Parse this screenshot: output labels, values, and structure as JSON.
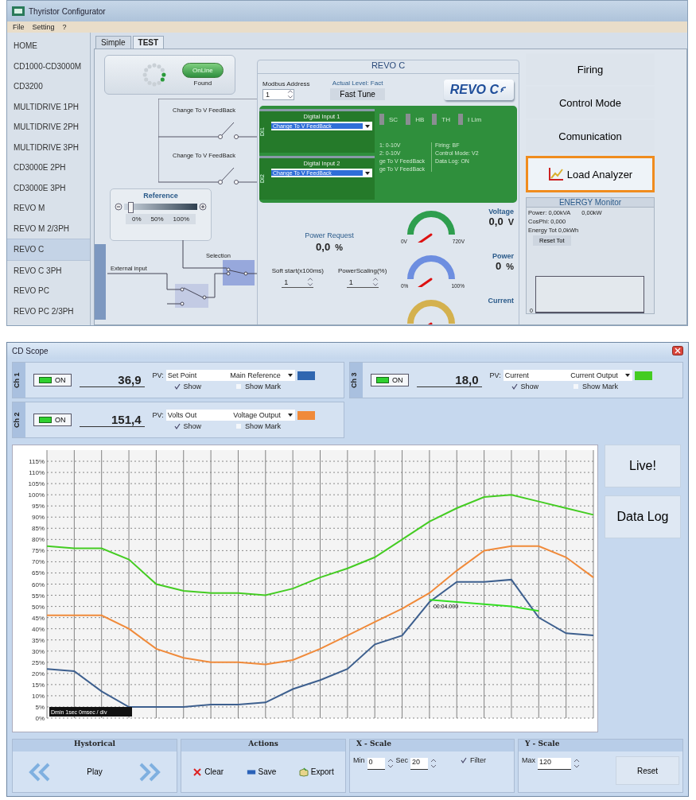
{
  "configurator": {
    "window": {
      "title": "Thyristor Configurator"
    },
    "menu": [
      "File",
      "Setting",
      "?"
    ],
    "sidebar": {
      "items": [
        {
          "label": "HOME",
          "selected": false
        },
        {
          "label": "CD1000-CD3000M",
          "selected": false
        },
        {
          "label": "CD3200",
          "selected": false
        },
        {
          "label": "MULTIDRIVE 1PH",
          "selected": false
        },
        {
          "label": "MULTIDRIVE 2PH",
          "selected": false
        },
        {
          "label": "MULTIDRIVE 3PH",
          "selected": false
        },
        {
          "label": "CD3000E 2PH",
          "selected": false
        },
        {
          "label": "CD3000E 3PH",
          "selected": false
        },
        {
          "label": "REVO M",
          "selected": false
        },
        {
          "label": "REVO M 2/3PH",
          "selected": false
        },
        {
          "label": "REVO C",
          "selected": true
        },
        {
          "label": "REVO C 3PH",
          "selected": false
        },
        {
          "label": "REVO PC",
          "selected": false
        },
        {
          "label": "REVO PC 2/3PH",
          "selected": false
        }
      ]
    },
    "tabs": [
      {
        "label": "Simple",
        "selected": false
      },
      {
        "label": "TEST",
        "selected": true
      }
    ],
    "connection": {
      "button": "OnLine",
      "status": "Found"
    },
    "switches": [
      {
        "label": "Change To V FeedBack"
      },
      {
        "label": "Change To V FeedBack"
      }
    ],
    "reference": {
      "title": "Reference",
      "level": 0.05,
      "scale": [
        "0%",
        "50%",
        "100%"
      ]
    },
    "external_input": "External input",
    "selection": "Selection",
    "revo": {
      "title": "REVO C",
      "modbus_label": "Modbus Address",
      "modbus_value": "1",
      "level_label": "Actual Level: Fact",
      "tune_button": "Fast Tune",
      "logo": "REVO C",
      "digital_inputs": [
        {
          "side": "DI1",
          "title": "Digital Input 1",
          "value": "Change To V FeedBack"
        },
        {
          "side": "DI2",
          "title": "Digital Input 2",
          "value": "Change To V FeedBack"
        }
      ],
      "alarms": [
        "SC",
        "HB",
        "TH",
        "I Lim"
      ],
      "inputs_info": [
        "1: 0-10V",
        "2: 0-10V",
        "ge To V FeedBack",
        "ge To V FeedBack"
      ],
      "status_info": [
        "Firing: BF",
        "Control Mode: V2",
        "Data Log: ON"
      ],
      "power_request": {
        "label": "Power Request",
        "value": "0,0",
        "unit": "%"
      },
      "soft_start": {
        "label": "Soft start(x100ms)",
        "value": "1"
      },
      "power_scaling": {
        "label": "PowerScaling(%)",
        "value": "1"
      },
      "meters": [
        {
          "label": "Voltage",
          "value": "0,0",
          "unit": "V",
          "min": "0V",
          "max": "720V",
          "color": "#2e9e4e"
        },
        {
          "label": "Power",
          "value": "0",
          "unit": "%",
          "min": "0%",
          "max": "100%",
          "color": "#6d8ee0"
        },
        {
          "label": "Current",
          "color": "#d4b14e"
        }
      ]
    },
    "buttons": [
      {
        "label": "Firing",
        "selected": false
      },
      {
        "label": "Control Mode",
        "selected": false
      },
      {
        "label": "Comunication",
        "selected": false
      },
      {
        "label": "Load Analyzer",
        "selected": true
      }
    ],
    "energy": {
      "title": "ENERGY Monitor",
      "power_kva": "Power: 0,00kVA",
      "power_kw": "0,00kW",
      "cosphi": "CosPhi: 0,000",
      "energy": "Energy Tot 0,0kWh",
      "reset": "Reset Tot",
      "axis_label": "0"
    }
  },
  "scope": {
    "window": {
      "title": "CD Scope"
    },
    "channels": [
      {
        "label": "Ch 1",
        "on_label": "ON",
        "on": true,
        "value": "36,9",
        "pv_label": "PV:",
        "signal": "Set Point",
        "source": "Main Reference",
        "color": "#2f66b0",
        "show_label": "Show",
        "show": true,
        "mark_label": "Show Mark",
        "mark": false
      },
      {
        "label": "Ch 3",
        "on_label": "ON",
        "on": true,
        "value": "18,0",
        "pv_label": "PV:",
        "signal": "Current",
        "source": "Current Output",
        "color": "#44cc22",
        "show_label": "Show",
        "show": true,
        "mark_label": "Show Mark",
        "mark": false
      },
      {
        "label": "Ch 2",
        "on_label": "ON",
        "on": true,
        "value": "151,4",
        "pv_label": "PV:",
        "signal": "Volts Out",
        "source": "Voltage Output",
        "color": "#f08a3a",
        "show_label": "Show",
        "show": true,
        "mark_label": "Show Mark",
        "mark": false
      }
    ],
    "chart_data": {
      "type": "line",
      "grid": true,
      "ylim": [
        0,
        120
      ],
      "yticks": [
        {
          "value": 0,
          "label": "0%"
        },
        {
          "value": 5,
          "label": "5%"
        },
        {
          "value": 10,
          "label": "10%"
        },
        {
          "value": 15,
          "label": "15%"
        },
        {
          "value": 20,
          "label": "20%"
        },
        {
          "value": 25,
          "label": "25%"
        },
        {
          "value": 30,
          "label": "30%"
        },
        {
          "value": 35,
          "label": "35%"
        },
        {
          "value": 40,
          "label": "40%"
        },
        {
          "value": 45,
          "label": "45%"
        },
        {
          "value": 50,
          "label": "50%"
        },
        {
          "value": 55,
          "label": "55%"
        },
        {
          "value": 60,
          "label": "60%"
        },
        {
          "value": 65,
          "label": "65%"
        },
        {
          "value": 70,
          "label": "70%"
        },
        {
          "value": 75,
          "label": "75%"
        },
        {
          "value": 80,
          "label": "80%"
        },
        {
          "value": 85,
          "label": "85%"
        },
        {
          "value": 90,
          "label": "90%"
        },
        {
          "value": 95,
          "label": "95%"
        },
        {
          "value": 100,
          "label": "100%"
        },
        {
          "value": 105,
          "label": "105%"
        },
        {
          "value": 110,
          "label": "110%"
        },
        {
          "value": 115,
          "label": "115%"
        }
      ],
      "categories": [
        null,
        null,
        null,
        null,
        null,
        null,
        null,
        null,
        null,
        null,
        null,
        null,
        null,
        null,
        null,
        null,
        null,
        null,
        null,
        null,
        null
      ],
      "series": [
        {
          "color": "#3d5f8e",
          "values": [
            22,
            21,
            12,
            5,
            5,
            5,
            6,
            6,
            7,
            13,
            17,
            22,
            33,
            37,
            52,
            61,
            61,
            62,
            45,
            38,
            37
          ]
        },
        {
          "color": "#f08a3a",
          "values": [
            46,
            46,
            46,
            40,
            31,
            27,
            25,
            25,
            24,
            26,
            31,
            37,
            43,
            49,
            56,
            66,
            75,
            77,
            77,
            72,
            63
          ]
        },
        {
          "color": "#44cc22",
          "values": [
            77,
            76,
            76,
            71,
            60,
            57,
            56,
            56,
            55,
            58,
            63,
            67,
            72,
            80,
            88,
            94,
            99,
            100,
            97,
            94,
            91
          ]
        },
        {
          "color": "#33dd22",
          "values": [
            null,
            null,
            null,
            null,
            null,
            null,
            null,
            null,
            null,
            null,
            null,
            null,
            null,
            null,
            53,
            52,
            51,
            50,
            48,
            null,
            null
          ]
        }
      ],
      "annotations": [
        {
          "text": "00:04.000"
        },
        {
          "text": "Dmin 1sec 0msec / div"
        }
      ]
    },
    "side_buttons": [
      "Live!",
      "Data Log"
    ],
    "historical": {
      "title": "Hystorical",
      "play": "Play"
    },
    "actions": {
      "title": "Actions",
      "buttons": [
        {
          "kind": "clear",
          "label": "Clear"
        },
        {
          "kind": "save",
          "label": "Save"
        },
        {
          "kind": "export",
          "label": "Export"
        }
      ]
    },
    "x_scale": {
      "title": "X - Scale",
      "min_label": "Min",
      "min": "0",
      "sec_label": "Sec",
      "sec": "20",
      "filter_label": "Filter",
      "filter": true
    },
    "y_scale": {
      "title": "Y - Scale",
      "max_label": "Max",
      "max": "120",
      "reset": "Reset"
    }
  }
}
